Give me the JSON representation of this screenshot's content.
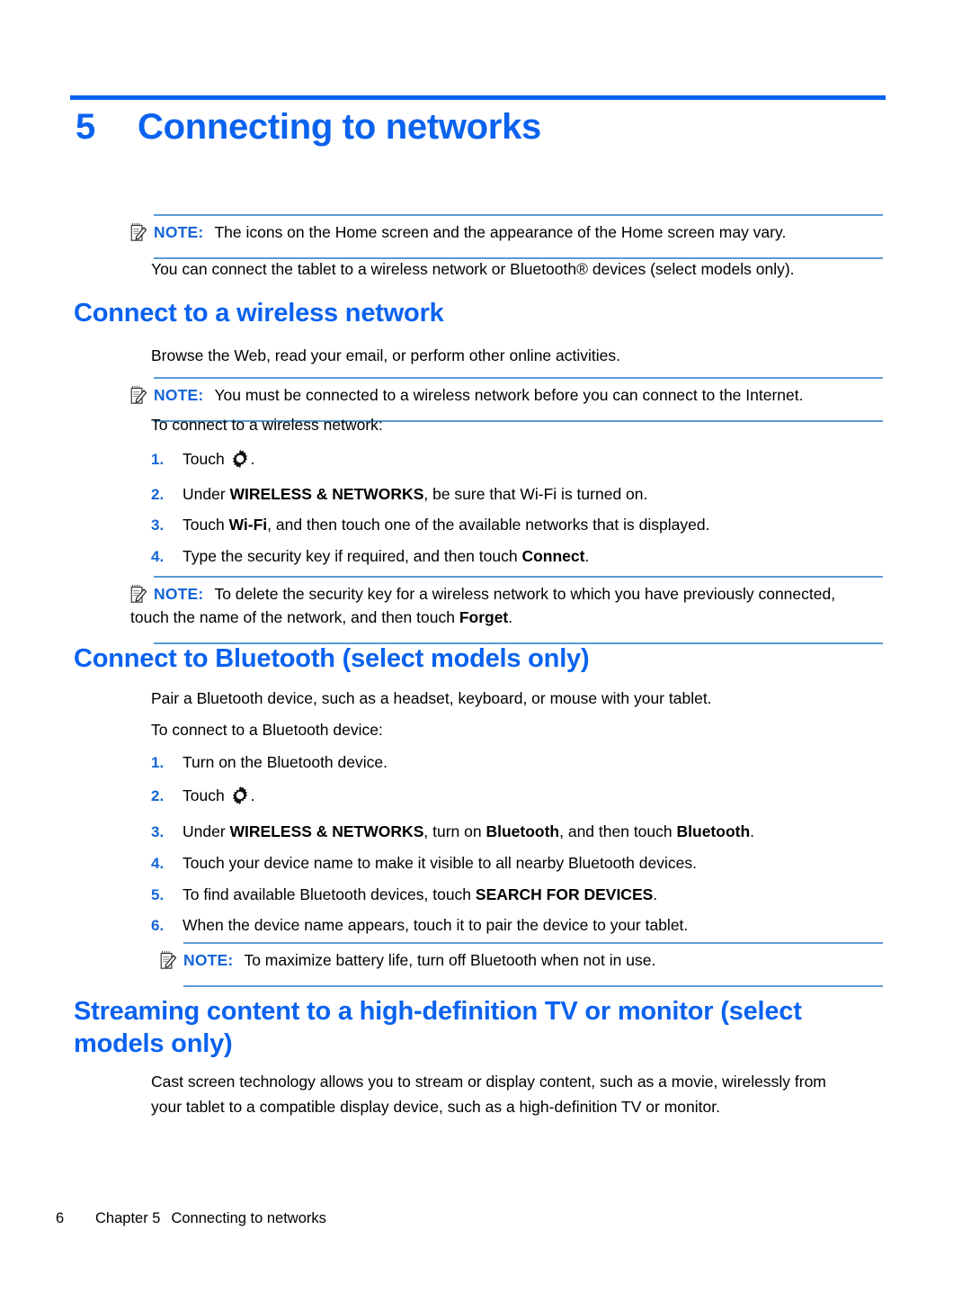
{
  "document": {
    "chapter_number": "5",
    "chapter_title": "Connecting to networks"
  },
  "notes": {
    "label": "NOTE:",
    "note1": "The icons on the Home screen and the appearance of the Home screen may vary.",
    "note2": "You must be connected to a wireless network before you can connect to the Internet.",
    "note3_line1": "To delete the security key for a wireless network to which you have previously connected,",
    "note3_line2_pre": "touch the name of the network, and then touch ",
    "note3_line2_bold": "Forget",
    "note3_line2_post": ".",
    "note4": "To maximize battery life, turn off Bluetooth when not in use."
  },
  "intro": {
    "paragraph": "You can connect the tablet to a wireless network or Bluetooth® devices (select models only)."
  },
  "wireless_section": {
    "heading": "Connect to a wireless network",
    "paragraph": "Browse the Web, read your email, or perform other online activities.",
    "lead_in": "To connect to a wireless network:",
    "steps": [
      {
        "marker": "1.",
        "pre": "Touch ",
        "icon": "gear-icon",
        "post": "."
      },
      {
        "marker": "2.",
        "pre": "Under ",
        "bold": "WIRELESS & NETWORKS",
        "post": ", be sure that Wi-Fi is turned on."
      },
      {
        "marker": "3.",
        "pre": "Touch ",
        "bold": "Wi-Fi",
        "post": ", and then touch one of the available networks that is displayed."
      },
      {
        "marker": "4.",
        "pre": "Type the security key if required, and then touch ",
        "bold": "Connect",
        "post": "."
      }
    ]
  },
  "bluetooth_section": {
    "heading": "Connect to Bluetooth (select models only)",
    "paragraph": "Pair a Bluetooth device, such as a headset, keyboard, or mouse with your tablet.",
    "lead_in": "To connect to a Bluetooth device:",
    "steps": [
      {
        "marker": "1.",
        "pre": "Turn on the Bluetooth device.",
        "bold": "",
        "post": ""
      },
      {
        "marker": "2.",
        "pre": "Touch ",
        "icon": "gear-icon",
        "post": "."
      },
      {
        "marker": "3.",
        "pre": "Under ",
        "bold": "WIRELESS & NETWORKS",
        "mid": ", turn on ",
        "bold2": "Bluetooth",
        "mid2": ", and then touch ",
        "bold3": "Bluetooth",
        "post": "."
      },
      {
        "marker": "4.",
        "pre": "Touch your device name to make it visible to all nearby Bluetooth devices.",
        "bold": "",
        "post": ""
      },
      {
        "marker": "5.",
        "pre": "To find available Bluetooth devices, touch ",
        "bold": "SEARCH FOR DEVICES",
        "post": "."
      },
      {
        "marker": "6.",
        "pre": "When the device name appears, touch it to pair the device to your tablet.",
        "bold": "",
        "post": ""
      }
    ]
  },
  "streaming_section": {
    "heading_line1": "Streaming content to a high-definition TV or monitor (select",
    "heading_line2": "models only)",
    "paragraph_line1": "Cast screen technology allows you to stream or display content, such as a movie, wirelessly from",
    "paragraph_line2": "your tablet to a compatible display device, such as a high-definition TV or monitor."
  },
  "footer": {
    "page_number": "6",
    "chapter_label": "Chapter 5",
    "chapter_title": "Connecting to networks"
  },
  "colors": {
    "heading_blue": "#0a62ef",
    "note_label_blue": "#1565d8",
    "note_rule_blue": "#5b9bd5",
    "text_black": "#000000"
  }
}
